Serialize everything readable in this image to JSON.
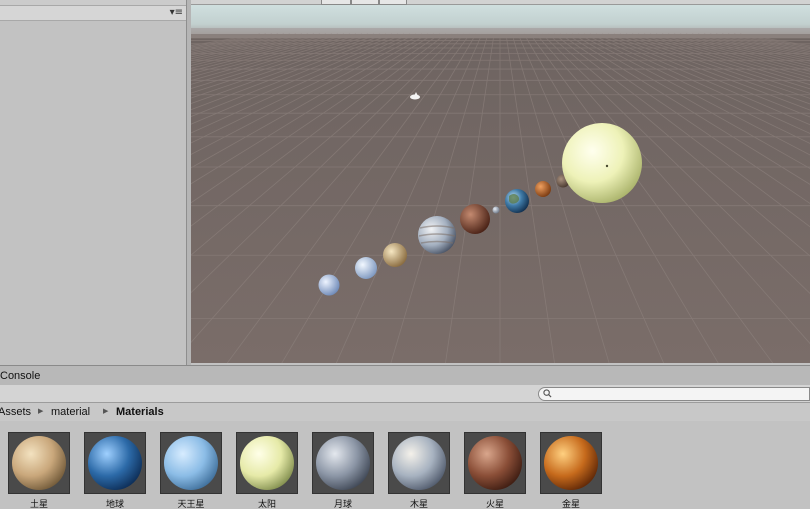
{
  "console_tab": {
    "label": "Console"
  },
  "breadcrumb": {
    "items": [
      "Assets",
      "material",
      "Materials"
    ]
  },
  "search": {
    "placeholder": ""
  },
  "materials": [
    {
      "label": "土星",
      "color_light": "#f3e2c0",
      "color_mid": "#c9a77b",
      "color_dark": "#6d5636"
    },
    {
      "label": "地球",
      "color_light": "#9fd0ff",
      "color_mid": "#2c6aa8",
      "color_dark": "#0b2a52"
    },
    {
      "label": "天王星",
      "color_light": "#d7ecff",
      "color_mid": "#8bbce6",
      "color_dark": "#3b6b97"
    },
    {
      "label": "太阳",
      "color_light": "#ffffe8",
      "color_mid": "#e6eaa8",
      "color_dark": "#7d8a4a"
    },
    {
      "label": "月球",
      "color_light": "#e4e8ee",
      "color_mid": "#8c96a6",
      "color_dark": "#3c4452"
    },
    {
      "label": "木星",
      "color_light": "#f4f1ea",
      "color_mid": "#a7b2c0",
      "color_dark": "#4c5668"
    },
    {
      "label": "火星",
      "color_light": "#d9a68c",
      "color_mid": "#8a4e37",
      "color_dark": "#3a1a10"
    },
    {
      "label": "金星",
      "color_light": "#ffd080",
      "color_mid": "#c66a1c",
      "color_dark": "#5a2406"
    }
  ],
  "scene": {
    "sky_color": "#d9e6e6",
    "ground_color": "#756864",
    "grid_color": "#8a7e7a"
  }
}
